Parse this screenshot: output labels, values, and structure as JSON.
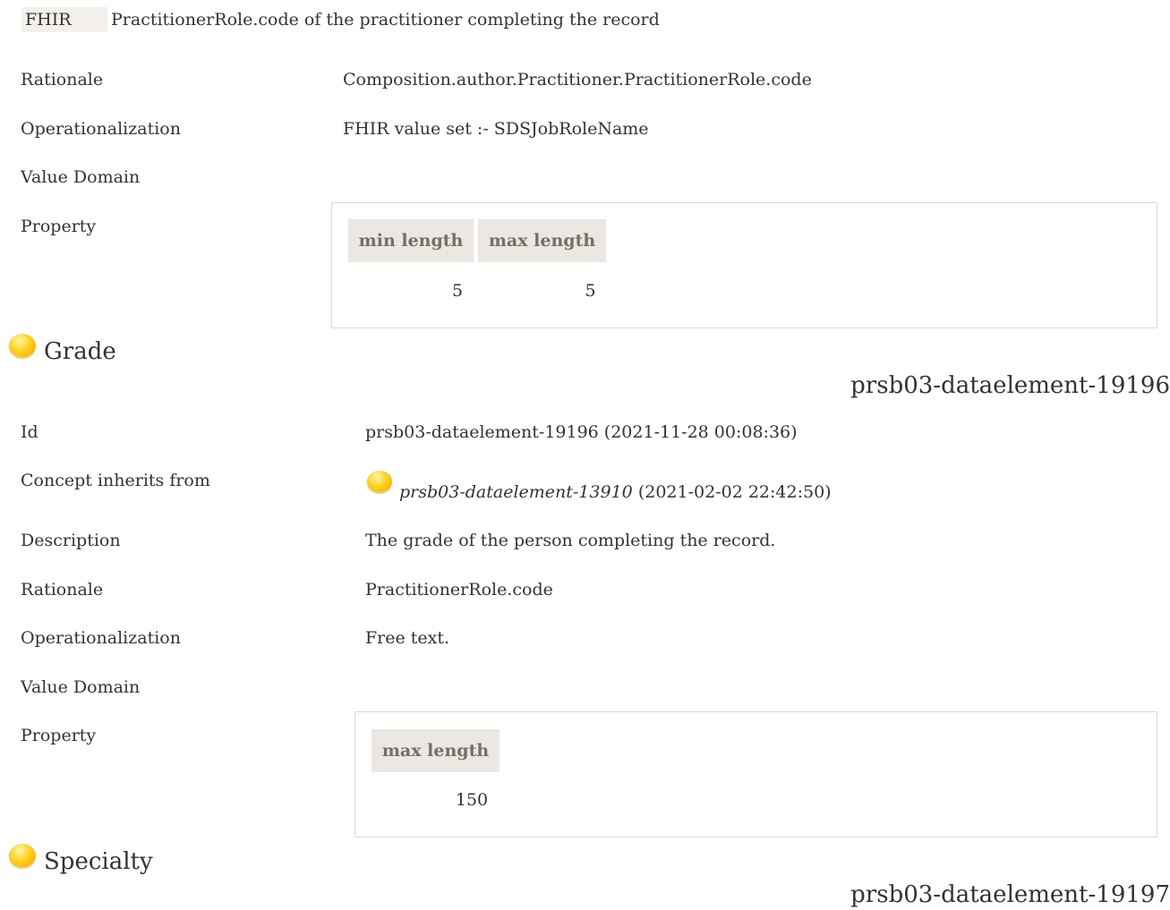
{
  "fhir_row": {
    "tag": "FHIR",
    "text": "PractitionerRole.code of the practitioner completing the record"
  },
  "role_block": {
    "rationale_label": "Rationale",
    "rationale_value": "Composition.author.Practitioner.PractitionerRole.code",
    "operationalization_label": "Operationalization",
    "operationalization_value": "FHIR value set :- SDSJobRoleName",
    "value_domain_label": "Value Domain",
    "property_label": "Property",
    "property_table": {
      "headers": [
        "min length",
        "max length"
      ],
      "values": [
        "5",
        "5"
      ]
    }
  },
  "grade": {
    "title": "Grade",
    "element_id": "prsb03-dataelement-19196",
    "id_label": "Id",
    "id_value": "prsb03-dataelement-19196 (2021-11-28 00:08:36)",
    "inherits_label": "Concept inherits from",
    "inherits_link": "prsb03-dataelement-13910",
    "inherits_date": "(2021-02-02 22:42:50)",
    "description_label": "Description",
    "description_value": "The grade of the person completing the record.",
    "rationale_label": "Rationale",
    "rationale_value": "PractitionerRole.code",
    "operationalization_label": "Operationalization",
    "operationalization_value": "Free text.",
    "value_domain_label": "Value Domain",
    "property_label": "Property",
    "property_table": {
      "headers": [
        "max length"
      ],
      "values": [
        "150"
      ]
    }
  },
  "specialty": {
    "title": "Specialty",
    "element_id": "prsb03-dataelement-19197"
  },
  "icons": {
    "concept_bullet": "concept-bullet-icon"
  },
  "colors": {
    "table_header_bg": "#ebe7e2",
    "table_header_text": "#7a6e63",
    "fhir_tag_bg": "#f3efea",
    "bullet": "#ffc400"
  }
}
